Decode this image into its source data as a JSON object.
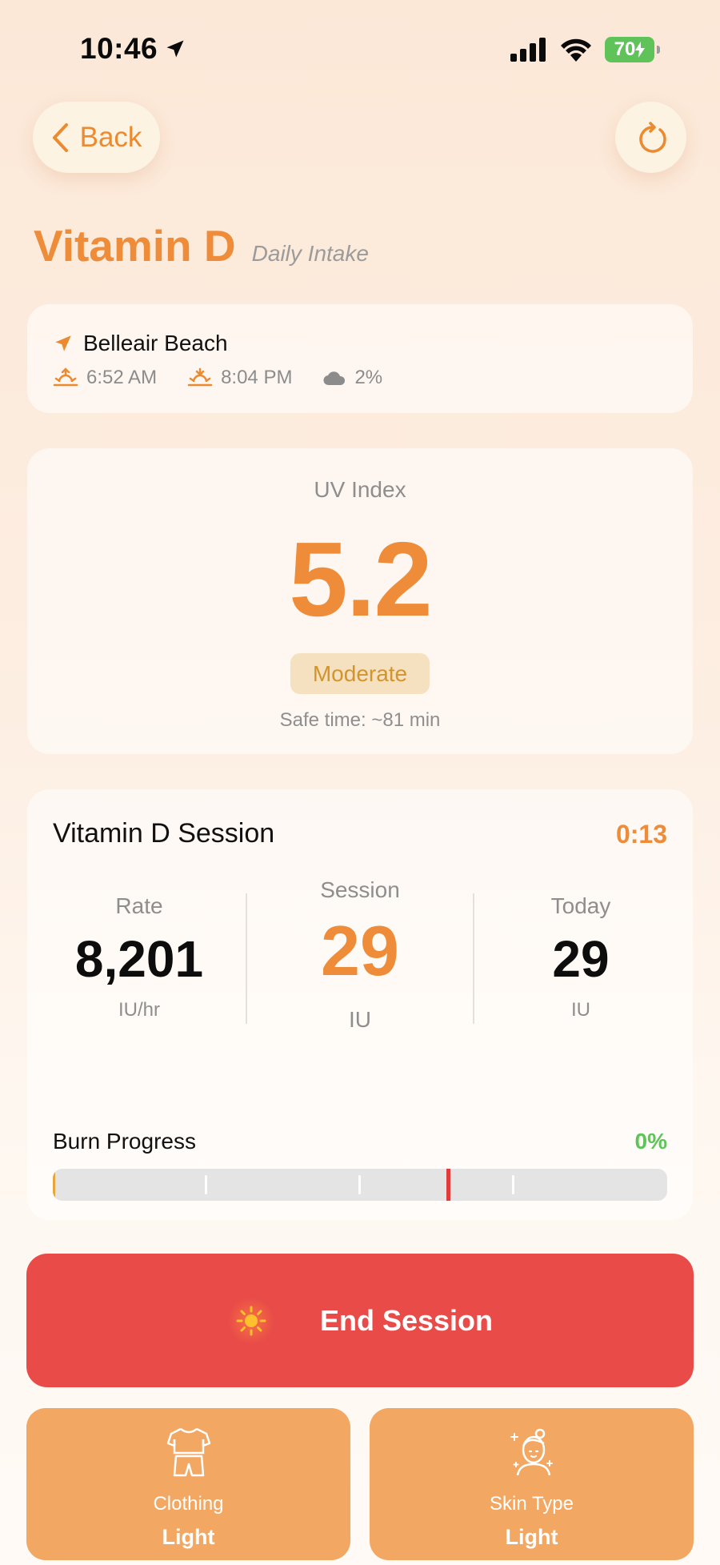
{
  "status_bar": {
    "time": "10:46",
    "battery": "70"
  },
  "nav": {
    "back_label": "Back"
  },
  "header": {
    "title": "Vitamin D",
    "subtitle": "Daily Intake"
  },
  "location": {
    "name": "Belleair Beach",
    "sunrise": "6:52 AM",
    "sunset": "8:04 PM",
    "cloud_cover": "2%"
  },
  "uv": {
    "label": "UV Index",
    "value": "5.2",
    "level": "Moderate",
    "safe_time": "Safe time: ~81 min"
  },
  "session": {
    "title": "Vitamin D Session",
    "timer": "0:13",
    "rate": {
      "label": "Rate",
      "value": "8,201",
      "unit": "IU/hr"
    },
    "current": {
      "label": "Session",
      "value": "29",
      "unit": "IU"
    },
    "today": {
      "label": "Today",
      "value": "29",
      "unit": "IU"
    }
  },
  "burn": {
    "label": "Burn Progress",
    "percent_text": "0%",
    "progress": 0,
    "limit_marker": 0.64
  },
  "actions": {
    "end_label": "End Session"
  },
  "options": {
    "clothing": {
      "label": "Clothing",
      "value": "Light"
    },
    "skin": {
      "label": "Skin Type",
      "value": "Light"
    }
  },
  "colors": {
    "accent": "#ee8c39",
    "danger": "#e94b48",
    "option_bg": "#f2a762",
    "success": "#5fc35a"
  }
}
